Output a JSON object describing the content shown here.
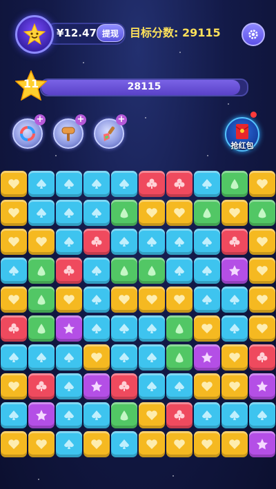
{
  "header": {
    "money": "¥12.47",
    "withdraw_label": "提现",
    "target_label": "目标分数: 29115"
  },
  "progress": {
    "level": "11",
    "score": "28115",
    "target": 29115
  },
  "tools": [
    {
      "name": "refresh-tool",
      "plus": "+"
    },
    {
      "name": "hammer-tool",
      "plus": "+"
    },
    {
      "name": "brush-tool",
      "plus": "+"
    }
  ],
  "red_packet": {
    "label": "抢红包"
  },
  "colors": {
    "yellow": "#f5b921",
    "blue": "#3ec4ef",
    "red": "#ef4a5e",
    "green": "#52c765",
    "purple": "#b44fe6"
  },
  "grid": [
    [
      "Y",
      "B",
      "B",
      "B",
      "B",
      "R",
      "R",
      "B",
      "G",
      "Y"
    ],
    [
      "Y",
      "B",
      "B",
      "B",
      "G",
      "Y",
      "Y",
      "G",
      "Y",
      "G"
    ],
    [
      "Y",
      "Y",
      "B",
      "R",
      "B",
      "B",
      "B",
      "B",
      "R",
      "Y"
    ],
    [
      "B",
      "G",
      "R",
      "B",
      "G",
      "G",
      "B",
      "B",
      "P",
      "Y"
    ],
    [
      "Y",
      "G",
      "Y",
      "B",
      "Y",
      "Y",
      "Y",
      "B",
      "B",
      "Y"
    ],
    [
      "R",
      "G",
      "P",
      "B",
      "B",
      "B",
      "G",
      "Y",
      "B",
      "Y"
    ],
    [
      "B",
      "B",
      "B",
      "Y",
      "B",
      "B",
      "G",
      "P",
      "Y",
      "R"
    ],
    [
      "Y",
      "R",
      "B",
      "P",
      "R",
      "B",
      "B",
      "Y",
      "Y",
      "P"
    ],
    [
      "B",
      "P",
      "B",
      "B",
      "G",
      "Y",
      "R",
      "B",
      "B",
      "B"
    ],
    [
      "Y",
      "Y",
      "B",
      "Y",
      "B",
      "Y",
      "Y",
      "Y",
      "Y",
      "P"
    ]
  ]
}
